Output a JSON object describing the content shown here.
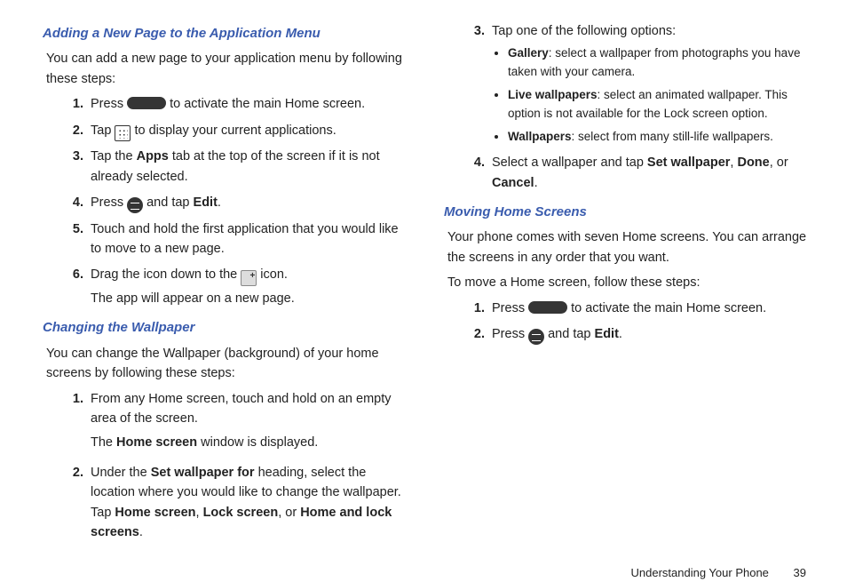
{
  "left": {
    "sectionA": {
      "heading": "Adding a New Page to the Application Menu",
      "intro": "You can add a new page to your application menu by following these steps:",
      "steps": {
        "s1_a": "Press ",
        "s1_b": " to activate the main Home screen.",
        "s2_a": "Tap ",
        "s2_b": " to display your current applications.",
        "s3_a": "Tap the ",
        "s3_bold": "Apps",
        "s3_b": " tab at the top of the screen if it is not already selected.",
        "s4_a": "Press ",
        "s4_b": " and tap ",
        "s4_bold": "Edit",
        "s4_c": ".",
        "s5": "Touch and hold the first application that you would like to move to a new page.",
        "s6_a": "Drag the icon down to the ",
        "s6_b": " icon.",
        "s6_sub": "The app will appear on a new page."
      }
    },
    "sectionB": {
      "heading": "Changing the Wallpaper",
      "intro": "You can change the Wallpaper (background) of your home screens by following these steps:",
      "steps": {
        "s1": "From any Home screen, touch and hold on an empty area of the screen.",
        "s1_sub_a": "The ",
        "s1_sub_bold": "Home screen",
        "s1_sub_b": " window is displayed.",
        "s2_a": "Under the ",
        "s2_bold1": "Set wallpaper for",
        "s2_b": " heading, select the location where you would like to change the wallpaper. Tap ",
        "s2_bold2": "Home screen",
        "s2_c": ", ",
        "s2_bold3": "Lock screen",
        "s2_d": ", or ",
        "s2_bold4": "Home and lock screens",
        "s2_e": "."
      }
    }
  },
  "right": {
    "s3_intro": "Tap one of the following options:",
    "bullets": {
      "b1_bold": "Gallery",
      "b1_text": ": select a wallpaper from photographs you have taken with your camera.",
      "b2_bold": "Live wallpapers",
      "b2_text": ": select an animated wallpaper. This option is not available for the Lock screen option.",
      "b3_bold": "Wallpapers",
      "b3_text": ": select from many still-life wallpapers."
    },
    "s4_a": "Select a wallpaper and tap ",
    "s4_bold1": "Set wallpaper",
    "s4_b": ", ",
    "s4_bold2": "Done",
    "s4_c": ", or ",
    "s4_bold3": "Cancel",
    "s4_d": ".",
    "sectionC": {
      "heading": "Moving Home Screens",
      "intro1": "Your phone comes with seven Home screens. You can arrange the screens in any order that you want.",
      "intro2": "To move a Home screen, follow these steps:",
      "steps": {
        "s1_a": "Press ",
        "s1_b": " to activate the main Home screen.",
        "s2_a": "Press ",
        "s2_b": " and tap ",
        "s2_bold": "Edit",
        "s2_c": "."
      }
    }
  },
  "footer": {
    "section": "Understanding Your Phone",
    "page": "39"
  }
}
